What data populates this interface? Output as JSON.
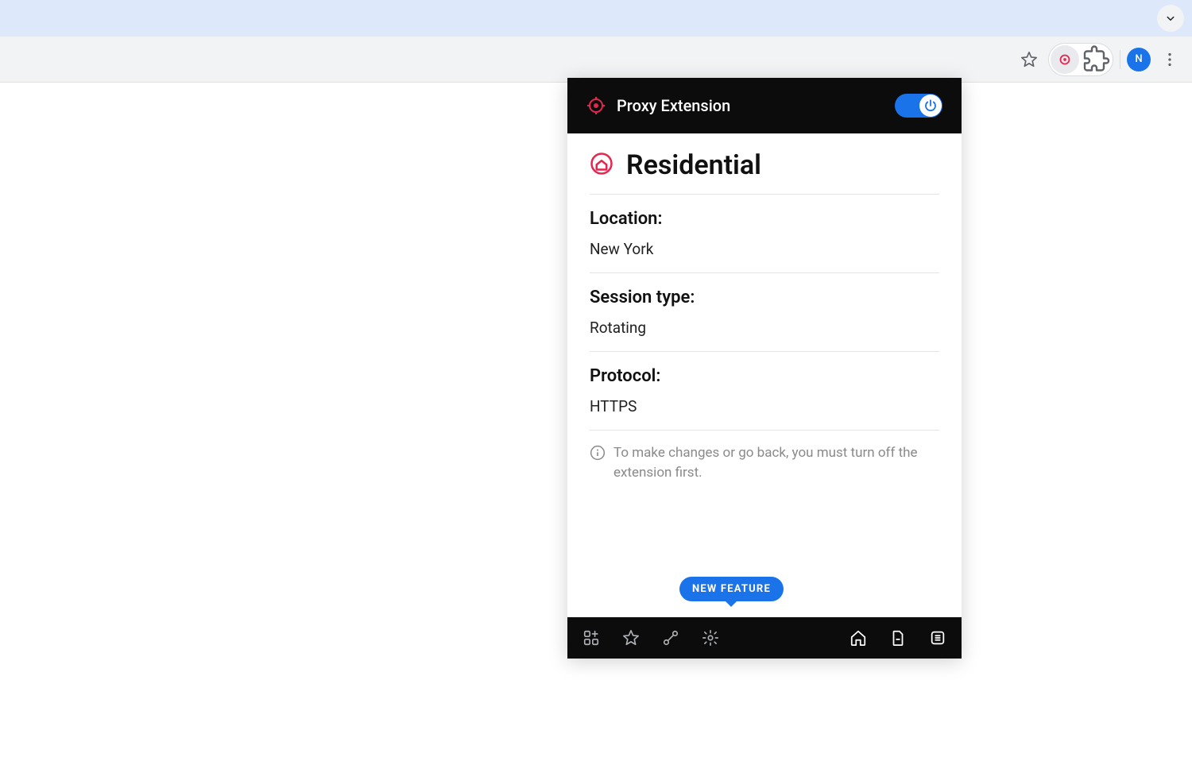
{
  "chrome": {
    "avatar_initial": "N"
  },
  "popup": {
    "header": {
      "title": "Proxy Extension",
      "toggle_on": true
    },
    "proxy_type": "Residential",
    "fields": {
      "location": {
        "label": "Location:",
        "value": "New York"
      },
      "session": {
        "label": "Session type:",
        "value": "Rotating"
      },
      "protocol": {
        "label": "Protocol:",
        "value": "HTTPS"
      }
    },
    "info_text": "To make changes or go back, you must turn off the extension first.",
    "badge": "NEW FEATURE",
    "footer": {
      "left_icons": [
        "apps-icon",
        "star-icon",
        "connect-icon",
        "settings-icon"
      ],
      "right_icons": [
        "home-icon",
        "file-icon",
        "list-icon"
      ]
    }
  }
}
